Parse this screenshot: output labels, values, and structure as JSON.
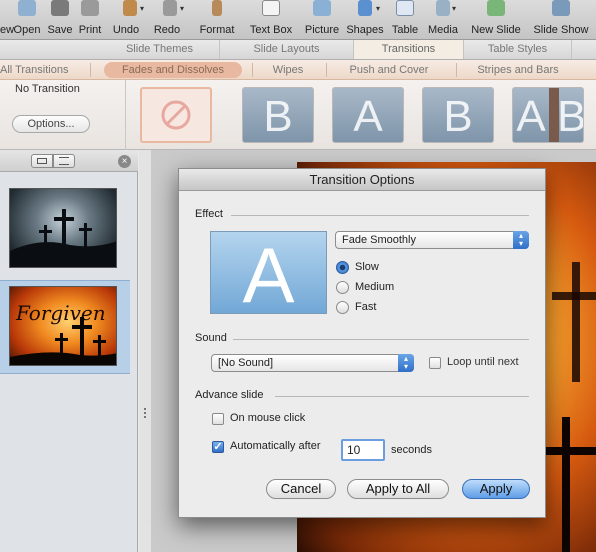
{
  "toolbar": {
    "items": [
      {
        "label": "ew"
      },
      {
        "label": "Open"
      },
      {
        "label": "Save"
      },
      {
        "label": "Print"
      },
      {
        "label": "Undo"
      },
      {
        "label": "Redo"
      },
      {
        "label": "Format"
      },
      {
        "label": "Text Box"
      },
      {
        "label": "Picture"
      },
      {
        "label": "Shapes"
      },
      {
        "label": "Table"
      },
      {
        "label": "Media"
      },
      {
        "label": "New Slide"
      },
      {
        "label": "Slide Show"
      }
    ]
  },
  "ribbon": {
    "tabs": [
      {
        "label": "Slide Themes"
      },
      {
        "label": "Slide Layouts"
      },
      {
        "label": "Transitions"
      },
      {
        "label": "Table Styles"
      }
    ],
    "categories": [
      {
        "label": "All Transitions"
      },
      {
        "label": "Fades and Dissolves"
      },
      {
        "label": "Wipes"
      },
      {
        "label": "Push and Cover"
      },
      {
        "label": "Stripes and Bars"
      }
    ]
  },
  "gallery": {
    "no_transition": "No Transition",
    "options_button": "Options...",
    "thumb_letters": [
      "B",
      "A",
      "B",
      "A",
      "B"
    ]
  },
  "slides": {
    "slide1_caption": "",
    "slide2_title": "Forgiven"
  },
  "dialog": {
    "title": "Transition Options",
    "effect_label": "Effect",
    "preview_letter": "A",
    "effect_select": "Fade Smoothly",
    "speed_options": [
      {
        "label": "Slow",
        "selected": true
      },
      {
        "label": "Medium",
        "selected": false
      },
      {
        "label": "Fast",
        "selected": false
      }
    ],
    "sound_label": "Sound",
    "sound_select": "[No Sound]",
    "loop_label": "Loop until next",
    "loop_checked": false,
    "advance_label": "Advance slide",
    "mouse_click_label": "On mouse click",
    "mouse_click_checked": false,
    "auto_after_label": "Automatically after",
    "auto_after_checked": true,
    "seconds_value": "10",
    "seconds_label": "seconds",
    "cancel_button": "Cancel",
    "apply_all_button": "Apply to All",
    "apply_button": "Apply"
  }
}
